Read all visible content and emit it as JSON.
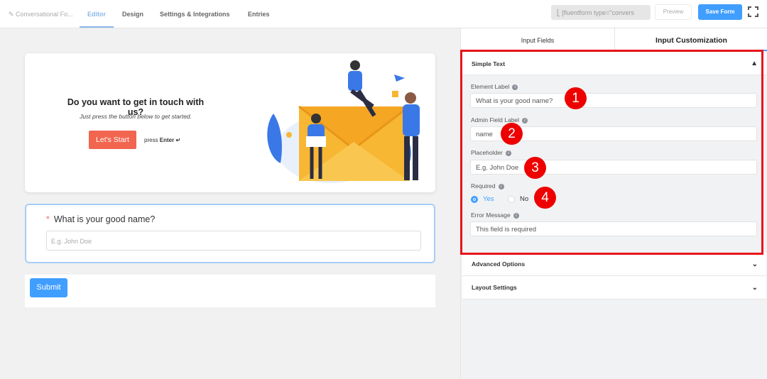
{
  "topbar": {
    "breadcrumb": "Conversational Fo...",
    "tabs": [
      "Editor",
      "Design",
      "Settings & Integrations",
      "Entries"
    ],
    "active_tab": "Editor",
    "shortcode": "[fluentform type=\"convers",
    "preview_label": "Preview",
    "save_label": "Save Form"
  },
  "welcome": {
    "title": "Do you want to get in touch with us?",
    "subtitle": "Just press the button below to get started.",
    "button": "Let's Start",
    "press": "press",
    "enter": "Enter ↵"
  },
  "question": {
    "required_mark": "*",
    "label": "What is your good name?",
    "placeholder": "E.g. John Doe"
  },
  "submit_label": "Submit",
  "panel": {
    "tabs": [
      "Input Fields",
      "Input Customization"
    ],
    "section": "Simple Text",
    "fields": {
      "element_label": {
        "label": "Element Label",
        "value": "What is your good name?"
      },
      "admin_label": {
        "label": "Admin Field Label",
        "value": "name"
      },
      "placeholder": {
        "label": "Placeholder",
        "value": "E.g. John Doe"
      },
      "required": {
        "label": "Required",
        "options": [
          "Yes",
          "No"
        ],
        "selected": "Yes"
      },
      "error_message": {
        "label": "Error Message",
        "value": "This field is required"
      }
    },
    "collapsed_sections": [
      "Advanced Options",
      "Layout Settings"
    ],
    "annotations": [
      "1",
      "2",
      "3",
      "4"
    ]
  },
  "colors": {
    "primary": "#409eff",
    "start_button": "#f2654f",
    "highlight": "#e8141b"
  }
}
